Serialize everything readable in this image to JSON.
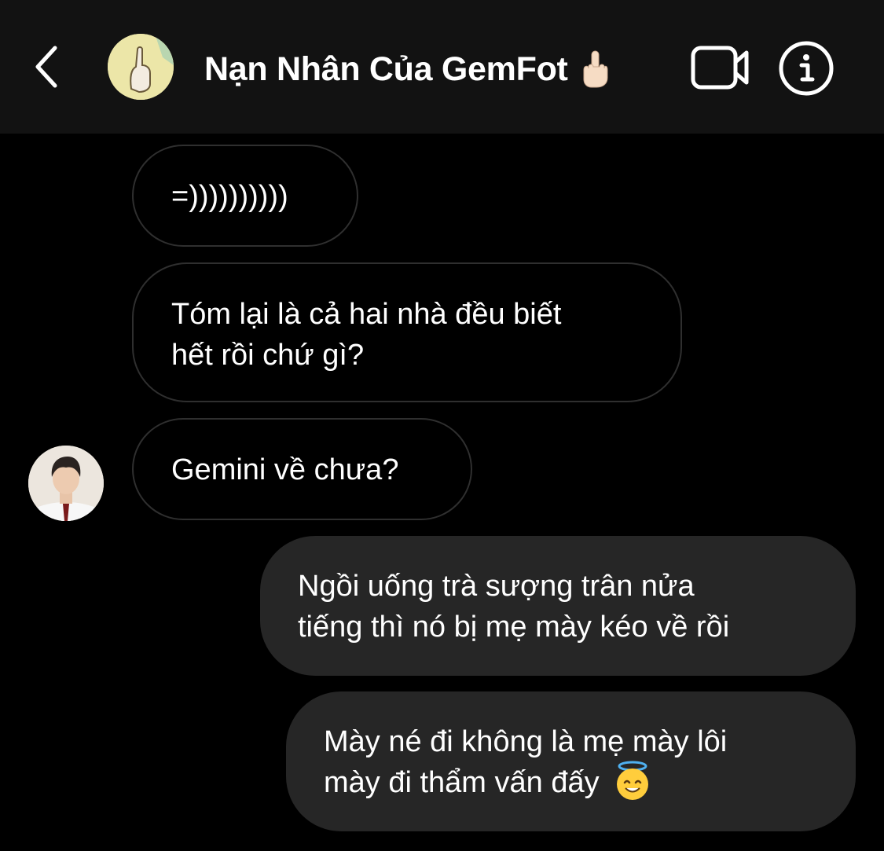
{
  "header": {
    "title": "Nạn Nhân Của GemFot",
    "title_emoji": "middle-finger-emoji",
    "back_icon": "chevron-left-icon",
    "video_icon": "video-camera-icon",
    "info_icon": "info-icon"
  },
  "messages": [
    {
      "direction": "incoming",
      "lines": [
        "=))))))))))"
      ]
    },
    {
      "direction": "incoming",
      "lines": [
        "Tóm lại là cả hai nhà đều biết",
        "hết rồi chứ gì?"
      ]
    },
    {
      "direction": "incoming",
      "lines": [
        "Gemini về chưa?"
      ],
      "avatar": "contact-avatar"
    },
    {
      "direction": "outgoing",
      "lines": [
        "Ngồi uống trà sượng trân nửa",
        "tiếng thì nó bị mẹ mày kéo về rồi"
      ]
    },
    {
      "direction": "outgoing",
      "lines": [
        "Mày né đi không là mẹ mày lôi",
        "mày đi thẩm vấn đấy"
      ],
      "trailing_emoji": "smiling-face-with-halo-emoji"
    }
  ],
  "colors": {
    "background": "#000000",
    "header_bg": "#121212",
    "incoming_border": "#2f2f2f",
    "outgoing_bg": "#262626",
    "text": "#ffffff"
  }
}
